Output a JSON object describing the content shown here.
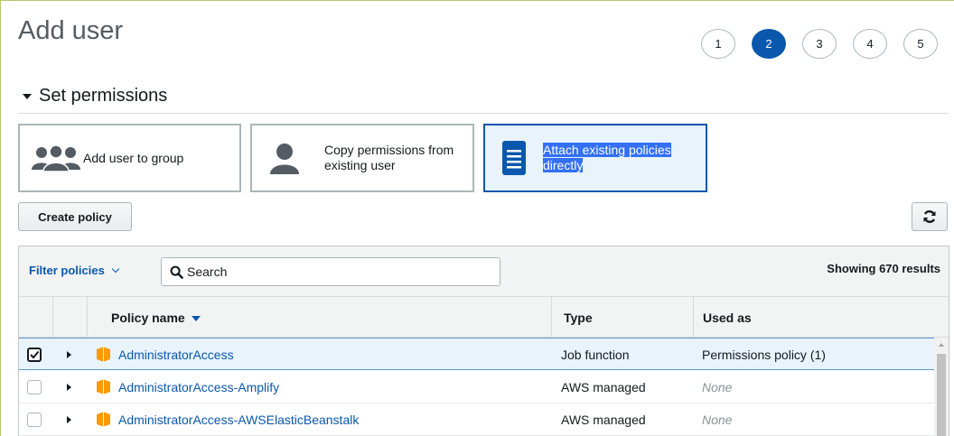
{
  "page": {
    "title": "Add user"
  },
  "steps": [
    "1",
    "2",
    "3",
    "4",
    "5"
  ],
  "active_step": "2",
  "section": {
    "title": "Set permissions"
  },
  "options": [
    {
      "label": "Add user to group",
      "icon": "group-icon",
      "selected": false
    },
    {
      "label": "Copy permissions from existing user",
      "icon": "user-icon",
      "selected": false
    },
    {
      "label": "Attach existing policies directly",
      "icon": "document-icon",
      "selected": true
    }
  ],
  "toolbar": {
    "create_policy_label": "Create policy",
    "refresh_icon": "refresh-icon"
  },
  "filter": {
    "label": "Filter policies",
    "search_placeholder": "Search",
    "results_text": "Showing 670 results"
  },
  "table": {
    "columns": {
      "policy_name": "Policy name",
      "type": "Type",
      "used_as": "Used as"
    },
    "rows": [
      {
        "checked": true,
        "name": "AdministratorAccess",
        "type": "Job function",
        "used_as": "Permissions policy (1)"
      },
      {
        "checked": false,
        "name": "AdministratorAccess-Amplify",
        "type": "AWS managed",
        "used_as": "None"
      },
      {
        "checked": false,
        "name": "AdministratorAccess-AWSElasticBeanstalk",
        "type": "AWS managed",
        "used_as": "None"
      }
    ]
  },
  "colors": {
    "accent": "#0a58ad",
    "selected_bg": "#e8f3fb",
    "policy_icon": "#ff9900",
    "text_highlight": "#3370f5"
  }
}
